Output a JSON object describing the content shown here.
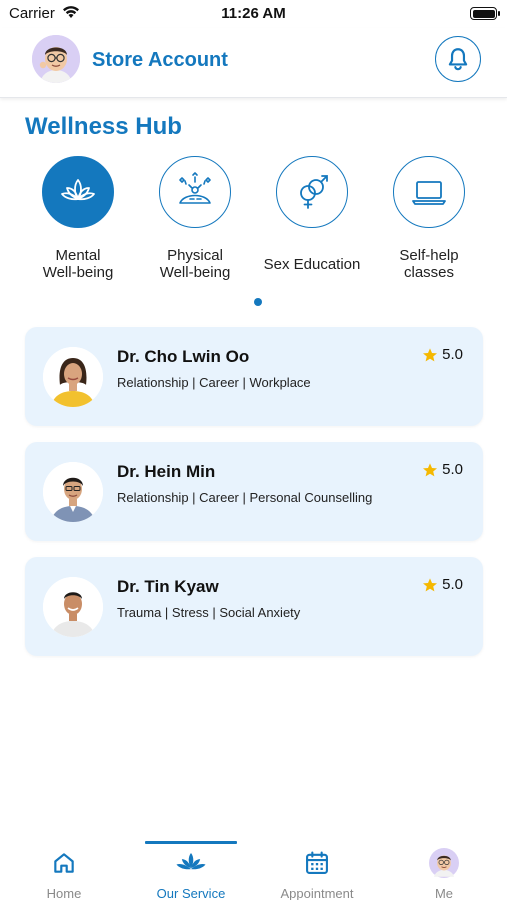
{
  "status_bar": {
    "carrier": "Carrier",
    "time": "11:26 AM"
  },
  "header": {
    "title": "Store Account"
  },
  "section": {
    "title": "Wellness Hub"
  },
  "categories": [
    {
      "label_line1": "Mental",
      "label_line2": "Well-being",
      "icon": "lotus-icon",
      "active": true
    },
    {
      "label_line1": "Physical",
      "label_line2": "Well-being",
      "icon": "physical-wellbeing-icon",
      "active": false
    },
    {
      "label_line1": "Sex Education",
      "label_line2": "",
      "icon": "gender-symbols-icon",
      "active": false
    },
    {
      "label_line1": "Self-help",
      "label_line2": "classes",
      "icon": "laptop-icon",
      "active": false
    }
  ],
  "doctors": [
    {
      "name": "Dr. Cho Lwin Oo",
      "specialties": "Relationship | Career | Workplace",
      "rating": "5.0"
    },
    {
      "name": "Dr. Hein Min",
      "specialties": "Relationship | Career | Personal Counselling",
      "rating": "5.0"
    },
    {
      "name": "Dr. Tin Kyaw",
      "specialties": "Trauma | Stress | Social Anxiety",
      "rating": "5.0"
    }
  ],
  "tabs": [
    {
      "label": "Home",
      "icon": "home-icon",
      "active": false
    },
    {
      "label": "Our Service",
      "icon": "lotus-icon",
      "active": true
    },
    {
      "label": "Appointment",
      "icon": "calendar-icon",
      "active": false
    },
    {
      "label": "Me",
      "icon": "avatar",
      "active": false
    }
  ],
  "colors": {
    "primary": "#1478be",
    "card_background": "#e8f3fd",
    "star": "#f5b800",
    "inactive_tab": "#8a8a8a"
  }
}
